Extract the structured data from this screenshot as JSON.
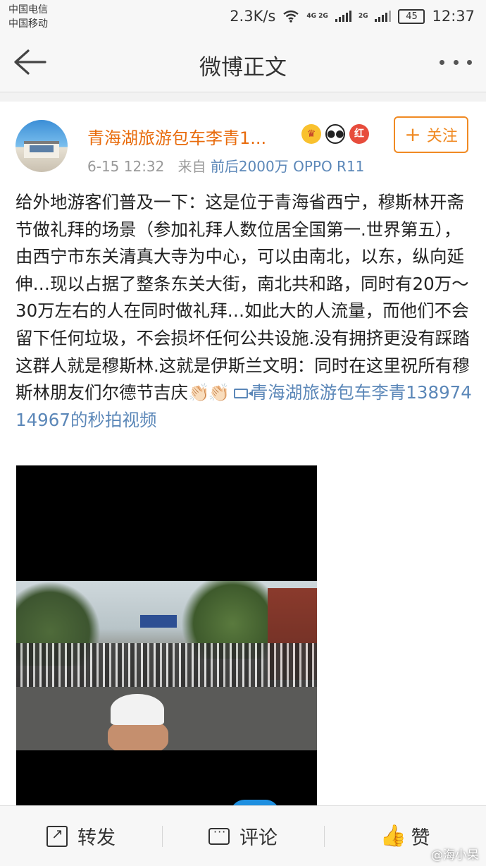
{
  "status_bar": {
    "carrier1": "中国电信",
    "carrier2": "中国移动",
    "speed": "2.3K/s",
    "net1": "4G 2G",
    "net2": "2G",
    "battery": "45",
    "time": "12:37"
  },
  "nav": {
    "title": "微博正文",
    "back_icon": "arrow-left-icon",
    "more_icon": "more-dots-icon"
  },
  "post": {
    "username": "青海湖旅游包车李青1...",
    "badges": [
      "crown-badge-icon",
      "panda-badge-icon",
      "red-badge-icon"
    ],
    "badge_red_label": "红",
    "time": "6-15 12:32",
    "from_label": "来自",
    "source": "前后2000万 OPPO R11",
    "follow_label": "关注",
    "content_text": "给外地游客们普及一下：这是位于青海省西宁，穆斯林开斋节做礼拜的场景（参加礼拜人数位居全国第一.世界第五），由西宁市东关清真大寺为中心，可以由南北，以东，纵向延伸…现以占据了整条东关大街，南北共和路，同时有20万～30万左右的人在同时做礼拜…如此大的人流量，而他们不会留下任何垃圾，不会损坏任何公共设施.没有拥挤更没有踩踏这群人就是穆斯林.这就是伊斯兰文明：同时在这里祝所有穆斯林朋友们尔德节吉庆",
    "content_emoji": "👏🏻👏🏻",
    "video_link": "青海湖旅游包车李青13897414967的秒拍视频"
  },
  "toolbar": {
    "repost": "转发",
    "comment": "评论",
    "like": "赞"
  },
  "watermark": "@海小呆",
  "colors": {
    "accent_orange": "#e86b0c",
    "link_blue": "#5b87b8",
    "follow_border": "#f08a23"
  }
}
